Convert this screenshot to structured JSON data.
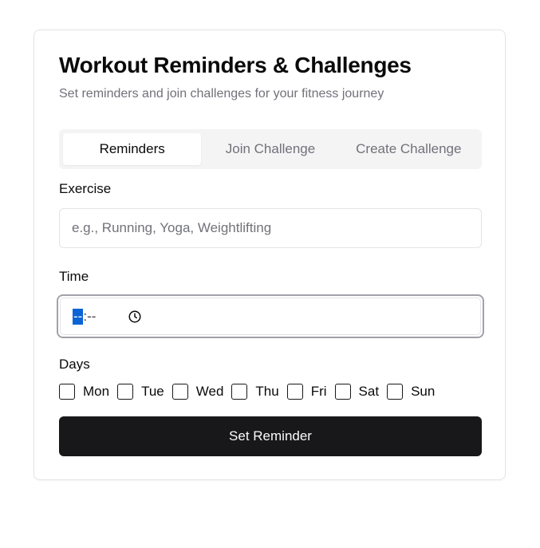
{
  "card": {
    "title": "Workout Reminders & Challenges",
    "subtitle": "Set reminders and join challenges for your fitness journey"
  },
  "tabs": [
    {
      "label": "Reminders",
      "active": true
    },
    {
      "label": "Join Challenge",
      "active": false
    },
    {
      "label": "Create Challenge",
      "active": false
    }
  ],
  "form": {
    "exercise_label": "Exercise",
    "exercise_placeholder": "e.g., Running, Yoga, Weightlifting",
    "exercise_value": "",
    "time_label": "Time",
    "time_hours": "--",
    "time_sep": ":",
    "time_minutes": "--",
    "days_label": "Days",
    "days": [
      {
        "label": "Mon",
        "checked": false
      },
      {
        "label": "Tue",
        "checked": false
      },
      {
        "label": "Wed",
        "checked": false
      },
      {
        "label": "Thu",
        "checked": false
      },
      {
        "label": "Fri",
        "checked": false
      },
      {
        "label": "Sat",
        "checked": false
      },
      {
        "label": "Sun",
        "checked": false
      }
    ],
    "submit_label": "Set Reminder"
  },
  "icons": {
    "time_icon": "clock-icon"
  },
  "colors": {
    "primary_button": "#18181b",
    "muted_text": "#71717a",
    "tab_track": "#f4f4f5",
    "selection": "#0a64d6"
  }
}
